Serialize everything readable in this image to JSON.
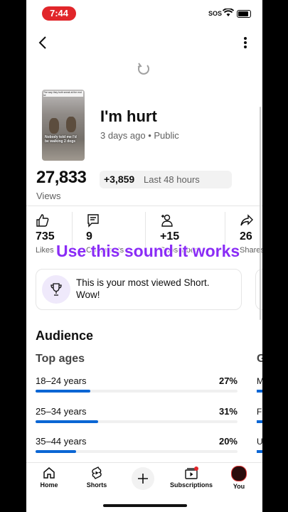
{
  "status": {
    "time": "7:44",
    "sos": "SOS"
  },
  "video": {
    "thumb_caption": "The way they both sneak at the end lol",
    "thumb_overlay": "Nobody told me I'd be walking 2 dogs",
    "title": "I'm hurt",
    "meta": "3 days ago • Public"
  },
  "views": {
    "count": "27,833",
    "label": "Views",
    "delta": "+3,859",
    "period": "Last 48 hours"
  },
  "stats": [
    {
      "value": "735",
      "label": "Likes",
      "icon": "thumbs-up-icon"
    },
    {
      "value": "9",
      "label": "Comments",
      "icon": "comment-icon"
    },
    {
      "value": "+15",
      "label": "Subscribers",
      "icon": "add-person-icon"
    },
    {
      "value": "26",
      "label": "Shares",
      "icon": "share-icon"
    }
  ],
  "overlay_text": "Use this sound it works",
  "highlight_card": {
    "text": "This is your most viewed Short. Wow!"
  },
  "audience": {
    "heading": "Audience",
    "top_ages_heading": "Top ages",
    "next_heading": "G",
    "ages": [
      {
        "label": "18–24 years",
        "pct": "27%",
        "value": 27
      },
      {
        "label": "25–34 years",
        "pct": "31%",
        "value": 31
      },
      {
        "label": "35–44 years",
        "pct": "20%",
        "value": 20
      }
    ],
    "side": [
      "M",
      "F",
      "U"
    ]
  },
  "nav": {
    "home": "Home",
    "shorts": "Shorts",
    "subscriptions": "Subscriptions",
    "you": "You"
  },
  "colors": {
    "accent": "#0b66d4",
    "overlay": "#8a2cf6",
    "pill": "#e1262a"
  }
}
